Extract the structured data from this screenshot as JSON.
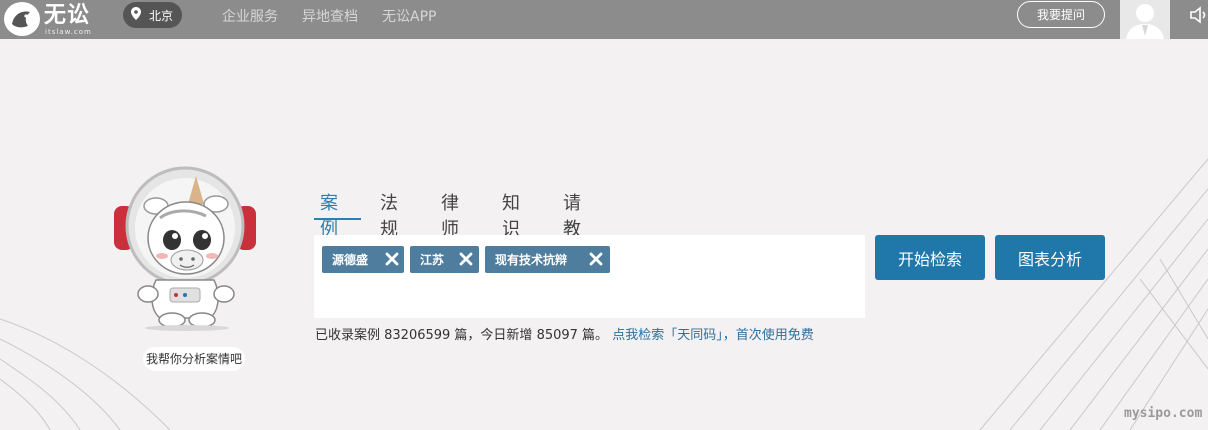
{
  "header": {
    "logo_text": "无讼",
    "logo_sub": "itslaw.com",
    "city": "北京",
    "nav": [
      {
        "label": "企业服务"
      },
      {
        "label": "异地查档"
      },
      {
        "label": "无讼APP"
      }
    ],
    "ask_label": "我要提问"
  },
  "mascot": {
    "caption": "我帮你分析案情吧"
  },
  "search": {
    "tabs": [
      {
        "label": "案例",
        "active": true
      },
      {
        "label": "法规",
        "active": false
      },
      {
        "label": "律师",
        "active": false
      },
      {
        "label": "知识",
        "active": false
      },
      {
        "label": "请教",
        "active": false
      }
    ],
    "chips": [
      {
        "label": "源德盛"
      },
      {
        "label": "江苏"
      },
      {
        "label": "现有技术抗辩"
      }
    ],
    "search_button": "开始检索",
    "chart_button": "图表分析",
    "stats_prefix": "已收录案例 83206599 篇，今日新增 85097 篇。",
    "stats_link": "点我检索「天同码」，首次使用免费"
  },
  "watermark": "mysipo.com",
  "colors": {
    "topbar": "#8c8c8c",
    "accent": "#2077aa",
    "chip": "#4e7d9e",
    "background": "#f3f1f2"
  }
}
